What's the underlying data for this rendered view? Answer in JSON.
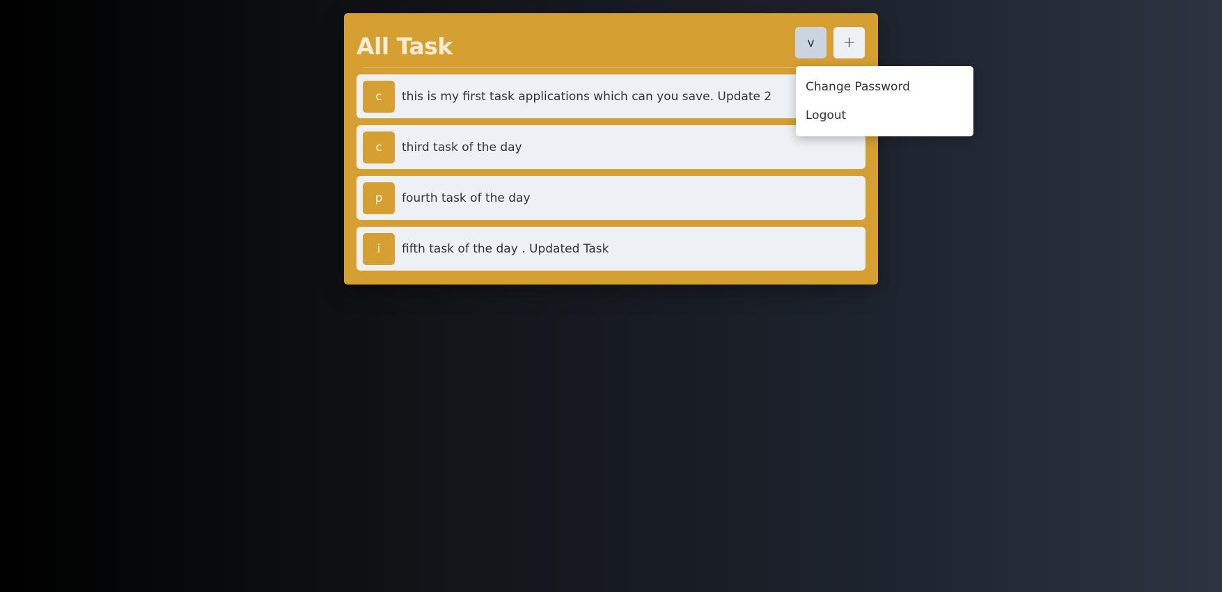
{
  "card": {
    "title": "All Task",
    "menu_button_label": "v",
    "add_button_label": "+"
  },
  "tasks": [
    {
      "badge": "c",
      "text": "this is my first task applications which can you save. Update 2"
    },
    {
      "badge": "c",
      "text": "third task of the day"
    },
    {
      "badge": "p",
      "text": "fourth task of the day"
    },
    {
      "badge": "i",
      "text": "fifth task of the day . Updated Task"
    }
  ],
  "dropdown": {
    "items": [
      {
        "label": "Change Password"
      },
      {
        "label": "Logout"
      }
    ]
  },
  "colors": {
    "accent": "#d69f32",
    "row_background": "#edf1f5",
    "menu_button_background": "#cbd5e1"
  }
}
